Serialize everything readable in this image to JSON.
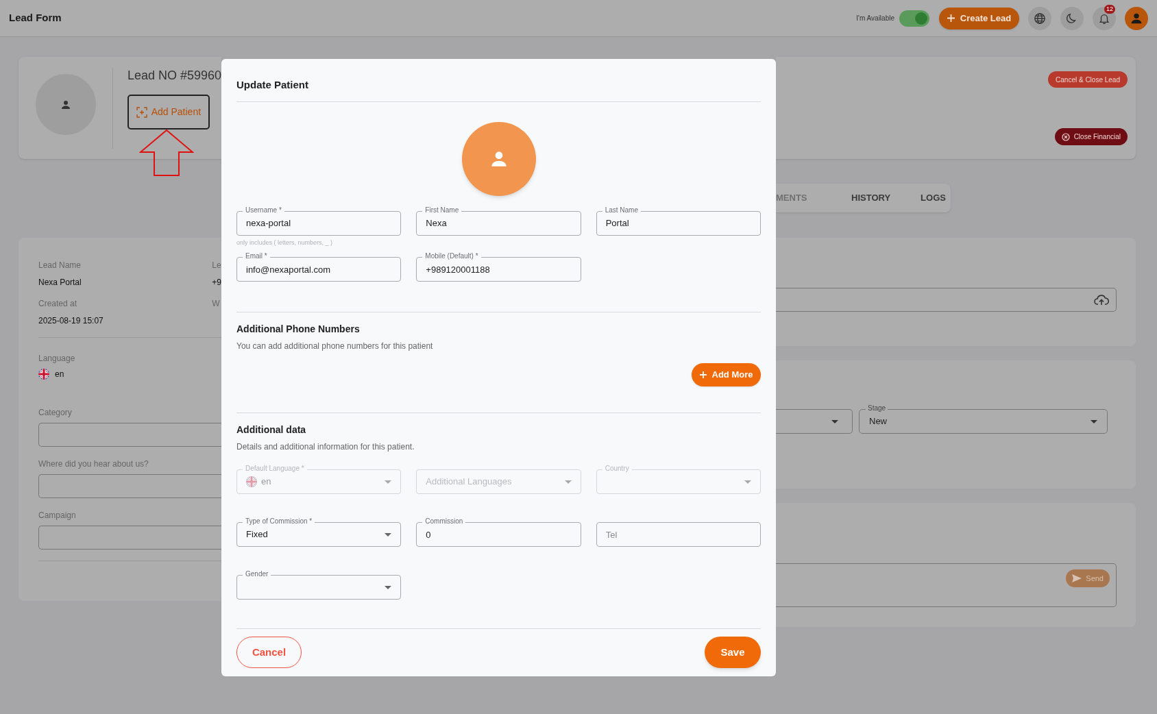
{
  "top_bar": {
    "title": "Lead Form",
    "availability_label": "I'm Available",
    "available": true,
    "create_button": "Create Lead",
    "notification_count": "12"
  },
  "lead_header": {
    "lead_number": "Lead NO #59960",
    "add_patient_button": "Add Patient",
    "cancel_close_button": "Cancel & Close Lead",
    "close_financial_button": "Close Financial"
  },
  "tabs": [
    {
      "label": "MENTS",
      "selected": false,
      "disabled": true
    },
    {
      "label": "HISTORY",
      "selected": false,
      "disabled": false
    },
    {
      "label": "LOGS",
      "selected": false,
      "disabled": false
    }
  ],
  "lead_info": {
    "fields": [
      {
        "label": "Lead Name",
        "value": "Nexa Portal"
      },
      {
        "label": "Created at",
        "value": "2025-08-19 15:07"
      }
    ],
    "column_2": [
      {
        "label": "Le",
        "value": "+9"
      },
      {
        "label": "W"
      }
    ],
    "language": {
      "label": "Language",
      "value": "en"
    },
    "inputs": [
      {
        "label": "Category"
      },
      {
        "label": "Where did you hear about us?"
      },
      {
        "label": "Campaign"
      }
    ]
  },
  "right_panels": {
    "stage": {
      "label": "Stage",
      "value": "New"
    },
    "send_button": "Send"
  },
  "modal": {
    "title": "Update Patient",
    "field_rows": [
      [
        {
          "kind": "text",
          "label": "Username *",
          "value": "nexa-portal",
          "hint": "only includes ( letters, numbers, _ )",
          "disabled": false
        },
        {
          "kind": "text",
          "label": "First Name",
          "value": "Nexa",
          "disabled": false
        },
        {
          "kind": "text",
          "label": "Last Name",
          "value": "Portal",
          "disabled": false
        }
      ],
      [
        {
          "kind": "text",
          "label": "Email *",
          "value": "info@nexaportal.com",
          "disabled": false
        },
        {
          "kind": "text",
          "label": "Mobile (Default) *",
          "value": "+989120001188",
          "disabled": false
        }
      ]
    ],
    "phone_section": {
      "title": "Additional Phone Numbers",
      "description": "You can add additional phone numbers for this patient",
      "add_button": "Add More"
    },
    "data_section": {
      "title": "Additional data",
      "description": "Details and additional information for this patient.",
      "field_rows": [
        [
          {
            "kind": "select",
            "label": "Default Language *",
            "value": "en",
            "flag": true,
            "disabled": true
          },
          {
            "kind": "select",
            "placeholder": "Additional Languages",
            "disabled": true
          },
          {
            "kind": "select",
            "label": "Country",
            "disabled": true
          }
        ],
        [
          {
            "kind": "select",
            "label": "Type of Commission *",
            "value": "Fixed",
            "disabled": false
          },
          {
            "kind": "text",
            "label": "Commission",
            "value": "0",
            "disabled": false
          },
          {
            "kind": "text",
            "placeholder": "Tel",
            "disabled": false
          }
        ],
        [
          {
            "kind": "select",
            "label": "Gender",
            "disabled": false
          }
        ]
      ]
    },
    "cancel_button": "Cancel",
    "save_button": "Save"
  }
}
